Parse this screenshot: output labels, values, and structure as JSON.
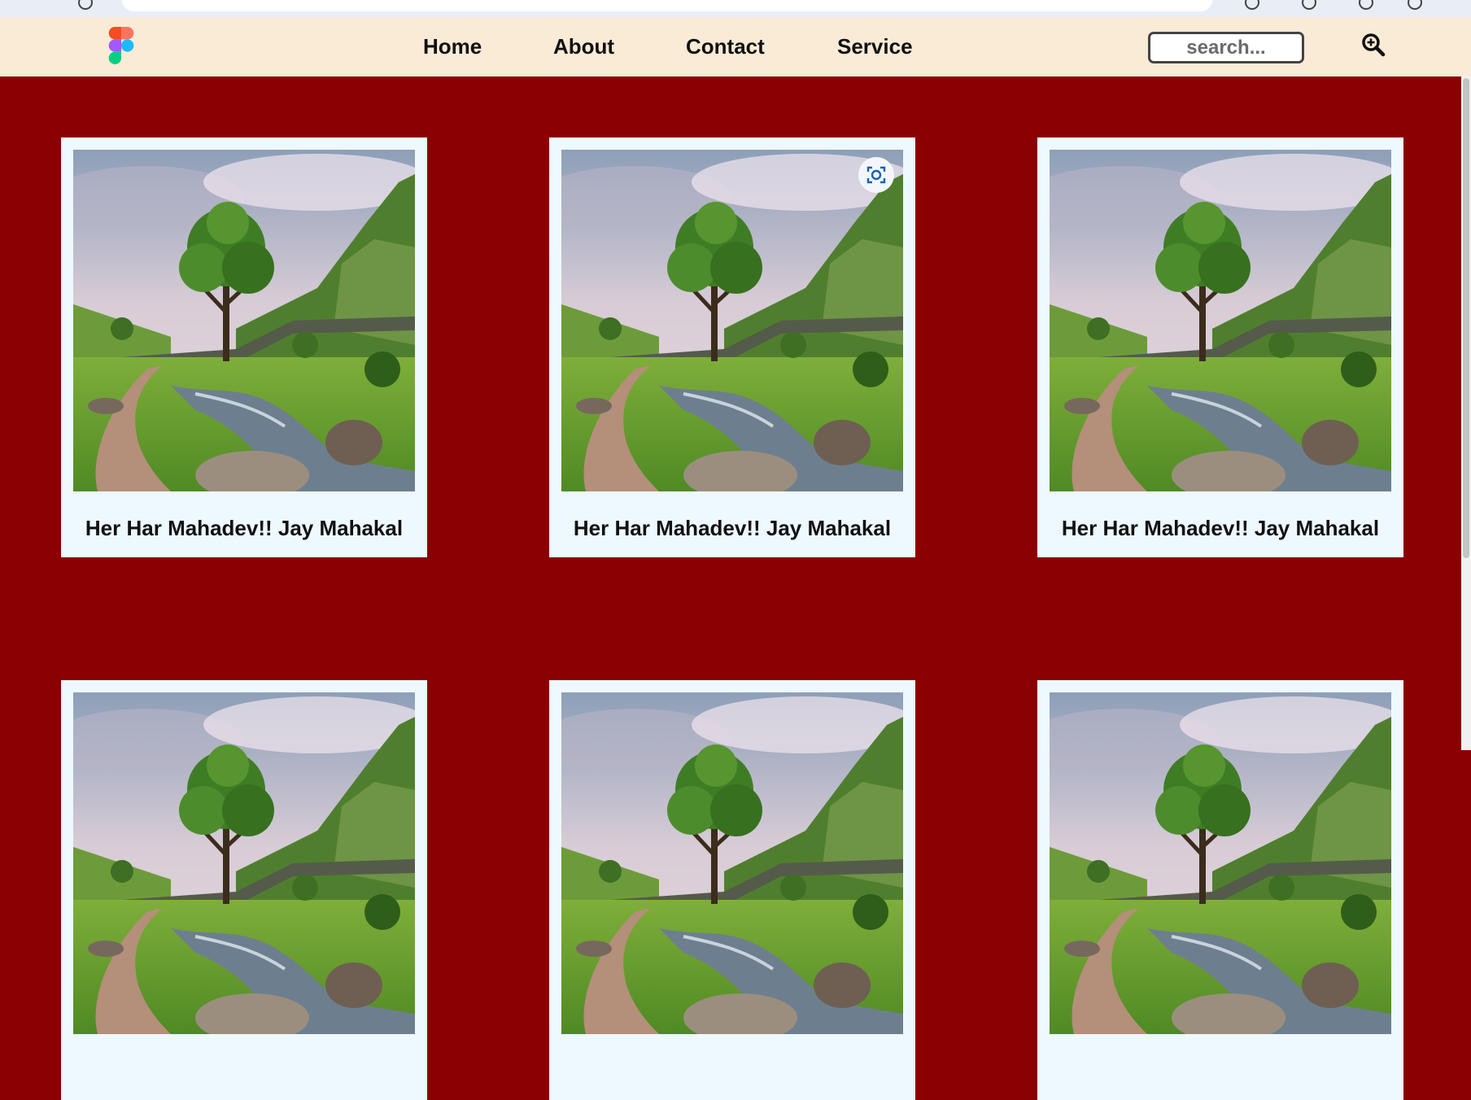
{
  "nav": {
    "links": [
      "Home",
      "About",
      "Contact",
      "Service"
    ],
    "search_placeholder": "search...",
    "search_icon": "magnifier-plus-icon",
    "logo_icon": "figma-logo-icon"
  },
  "colors": {
    "page_background": "#8b0000",
    "navbar_background": "#faebd7",
    "card_background": "#eef8ff"
  },
  "cards": [
    {
      "caption": "Her Har Mahadev!! Jay Mahakal"
    },
    {
      "caption": "Her Har Mahadev!! Jay Mahakal"
    },
    {
      "caption": "Her Har Mahadev!! Jay Mahakal"
    },
    {
      "caption": ""
    },
    {
      "caption": ""
    },
    {
      "caption": ""
    }
  ],
  "overlay": {
    "lens_icon": "google-lens-icon"
  }
}
